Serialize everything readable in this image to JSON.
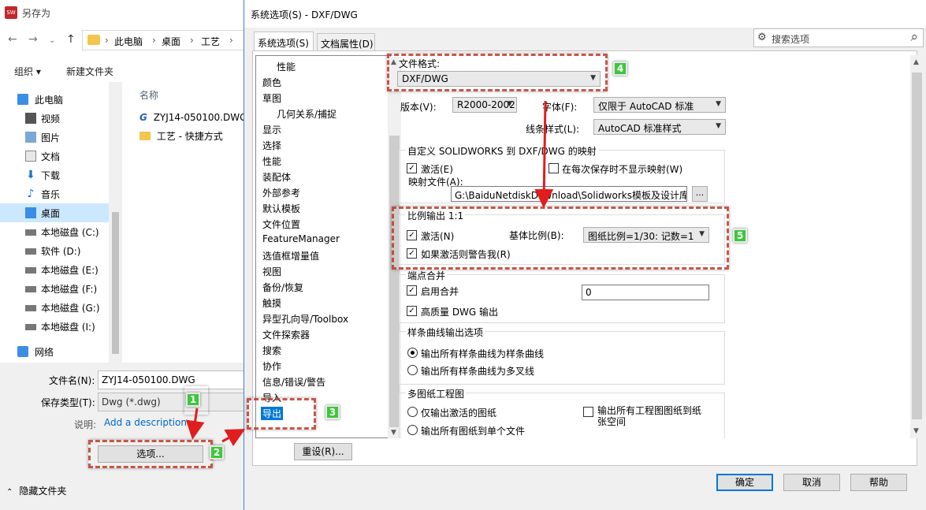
{
  "saveas": {
    "title": "另存为",
    "breadcrumbs": [
      "此电脑",
      "桌面",
      "工艺"
    ],
    "organize": "组织 ▾",
    "new_folder": "新建文件夹",
    "nav": [
      {
        "label": "此电脑",
        "icon": "computer-icon"
      },
      {
        "label": "视频",
        "icon": "video-folder-icon"
      },
      {
        "label": "图片",
        "icon": "pictures-folder-icon"
      },
      {
        "label": "文档",
        "icon": "documents-folder-icon"
      },
      {
        "label": "下载",
        "icon": "download-folder-icon"
      },
      {
        "label": "音乐",
        "icon": "music-folder-icon"
      },
      {
        "label": "桌面",
        "icon": "desktop-folder-icon"
      },
      {
        "label": "本地磁盘 (C:)",
        "icon": "drive-icon"
      },
      {
        "label": "软件 (D:)",
        "icon": "drive-icon"
      },
      {
        "label": "本地磁盘 (E:)",
        "icon": "drive-icon"
      },
      {
        "label": "本地磁盘 (F:)",
        "icon": "drive-icon"
      },
      {
        "label": "本地磁盘 (G:)",
        "icon": "drive-icon"
      },
      {
        "label": "本地磁盘 (I:)",
        "icon": "drive-icon"
      },
      {
        "label": "网络",
        "icon": "network-icon"
      }
    ],
    "files_header": "名称",
    "files": [
      "ZYJ14-050100.DWG",
      "工艺 - 快捷方式"
    ],
    "filename_label": "文件名(N):",
    "filename_value": "ZYJ14-050100.DWG",
    "filetype_label": "保存类型(T):",
    "filetype_value": "Dwg (*.dwg)",
    "desc_label": "说明:",
    "desc_link": "Add a description",
    "options_button": "选项...",
    "hide_folders": "隐藏文件夹"
  },
  "dialog": {
    "title": "系统选项(S) - DXF/DWG",
    "search_placeholder": "搜索选项",
    "tabs": [
      "系统选项(S)",
      "文档属性(D)"
    ],
    "tree": [
      "性能",
      "颜色",
      "草图",
      "几何关系/捕捉",
      "显示",
      "选择",
      "性能",
      "装配体",
      "外部参考",
      "默认模板",
      "文件位置",
      "FeatureManager",
      "选值框增量值",
      "视图",
      "备份/恢复",
      "触摸",
      "异型孔向导/Toolbox",
      "文件探索器",
      "搜索",
      "协作",
      "信息/错误/警告",
      "导入",
      "导出"
    ],
    "reset_button": "重设(R)...",
    "file_format_label": "文件格式:",
    "file_format_value": "DXF/DWG",
    "version_label": "版本(V):",
    "version_value": "R2000-2002",
    "font_label": "字体(F):",
    "font_value": "仅限于 AutoCAD 标准",
    "linestyle_label": "线条样式(L):",
    "linestyle_value": "AutoCAD 标准样式",
    "mapping_group": "自定义 SOLIDWORKS 到 DXF/DWG 的映射",
    "mapping_activate": "激活(E)",
    "mapping_noshow": "在每次保存时不显示映射(W)",
    "mapping_file_label": "映射文件(A):",
    "mapping_file_value": "G:\\BaiduNetdiskDownload\\Solidworks模板及设计库\\",
    "browse_button": "...",
    "scale_group": "比例输出 1:1",
    "scale_activate": "激活(N)",
    "base_scale_label": "基体比例(B):",
    "base_scale_value": "图纸比例=1/30: 记数=1",
    "scale_warn": "如果激活则警告我(R)",
    "merge_group": "端点合并",
    "merge_enable": "启用合并",
    "merge_value": "0",
    "hq_output": "高质量 DWG 输出",
    "spline_group": "样条曲线输出选项",
    "spline_opt1": "输出所有样条曲线为样条曲线",
    "spline_opt2": "输出所有样条曲线为多叉线",
    "multi_group": "多图纸工程图",
    "multi_opt1": "仅输出激活的图纸",
    "multi_opt2": "输出所有图纸到单个文件",
    "multi_opt3": "输出所有工程图图纸到纸张空间",
    "ok": "确定",
    "cancel": "取消",
    "help": "帮助"
  },
  "annotations": [
    "1",
    "2",
    "3",
    "4",
    "5"
  ],
  "colors": {
    "accent": "#0078d7",
    "annotation": "#c0392b",
    "badge": "#3cc83c"
  }
}
